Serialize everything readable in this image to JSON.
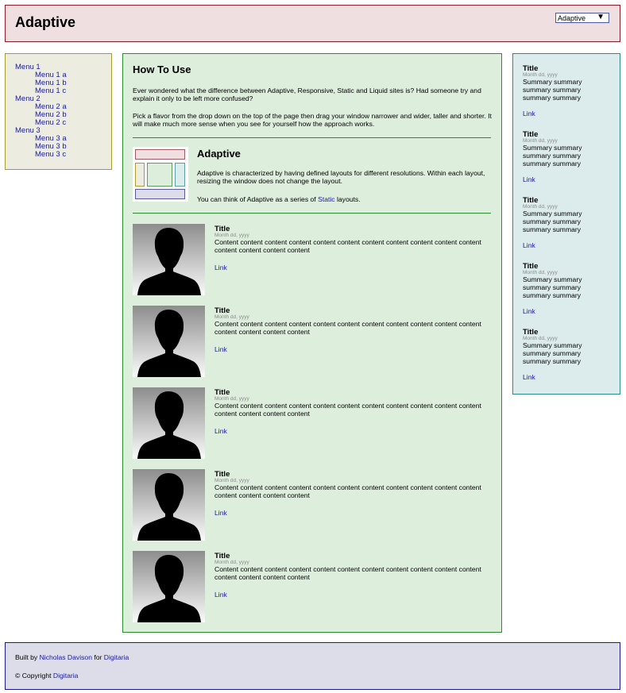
{
  "header": {
    "title": "Adaptive",
    "flavor_select": {
      "value": "Adaptive",
      "arrow": "▼"
    }
  },
  "menu": {
    "items": [
      {
        "label": "Menu 1",
        "children": [
          "Menu 1 a",
          "Menu 1 b",
          "Menu 1 c"
        ]
      },
      {
        "label": "Menu 2",
        "children": [
          "Menu 2 a",
          "Menu 2 b",
          "Menu 2 c"
        ]
      },
      {
        "label": "Menu 3",
        "children": [
          "Menu 3 a",
          "Menu 3 b",
          "Menu 3 c"
        ]
      }
    ]
  },
  "howto": {
    "title": "How To Use",
    "para1": "Ever wondered what the difference between Adaptive, Responsive, Static and Liquid sites is? Had someone try and explain it only to be left more confused?",
    "para2": "Pick a flavor from the drop down on the top of the page then drag your window narrower and wider, taller and shorter. It will make much more sense when you see for yourself how the approach works."
  },
  "adaptive": {
    "title": "Adaptive",
    "desc": "Adaptive is characterized by having defined layouts for different resolutions. Within each layout, resizing the window does not change the layout.",
    "series_prefix": "You can think of Adaptive as a series of ",
    "series_link": "Static",
    "series_suffix": " layouts."
  },
  "entries": [
    {
      "title": "Title",
      "date": "Month dd, yyyy",
      "body": "Content content content content content content content content content content content content content content content",
      "link": "Link"
    },
    {
      "title": "Title",
      "date": "Month dd, yyyy",
      "body": "Content content content content content content content content content content content content content content content",
      "link": "Link"
    },
    {
      "title": "Title",
      "date": "Month dd, yyyy",
      "body": "Content content content content content content content content content content content content content content content",
      "link": "Link"
    },
    {
      "title": "Title",
      "date": "Month dd, yyyy",
      "body": "Content content content content content content content content content content content content content content content",
      "link": "Link"
    },
    {
      "title": "Title",
      "date": "Month dd, yyyy",
      "body": "Content content content content content content content content content content content content content content content",
      "link": "Link"
    }
  ],
  "sidebar": {
    "items": [
      {
        "title": "Title",
        "date": "Month dd, yyyy",
        "summary": "Summary summary summary summary summary summary",
        "link": "Link"
      },
      {
        "title": "Title",
        "date": "Month dd, yyyy",
        "summary": "Summary summary summary summary summary summary",
        "link": "Link"
      },
      {
        "title": "Title",
        "date": "Month dd, yyyy",
        "summary": "Summary summary summary summary summary summary",
        "link": "Link"
      },
      {
        "title": "Title",
        "date": "Month dd, yyyy",
        "summary": "Summary summary summary summary summary summary",
        "link": "Link"
      },
      {
        "title": "Title",
        "date": "Month dd, yyyy",
        "summary": "Summary summary summary summary summary summary",
        "link": "Link"
      }
    ]
  },
  "footer": {
    "built_by_prefix": "Built by ",
    "author": "Nicholas Davison",
    "for_text": " for ",
    "company": "Digitaria",
    "copyright_prefix": "© Copyright ",
    "copyright_company": "Digitaria"
  },
  "colors": {
    "header_bg": "#efdfe0",
    "menu_bg": "#ecede0",
    "main_bg": "#ddeedd",
    "sidebar_bg": "#dcecec",
    "footer_bg": "#dddde9",
    "link": "#1a1aa6"
  }
}
